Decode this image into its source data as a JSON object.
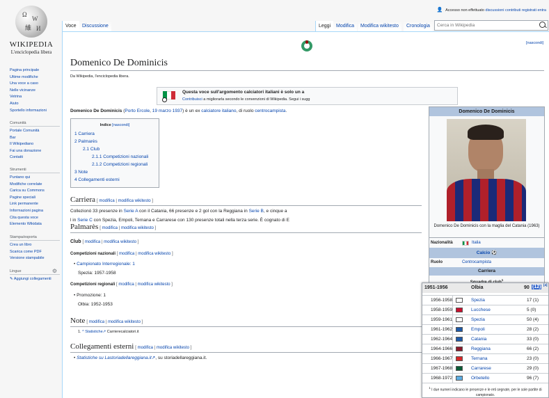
{
  "logo": {
    "wordmark": "WIKIPEDIA",
    "tagline": "L'enciclopedia libera"
  },
  "personal": [
    "Accesso non effettuato",
    "discussioni",
    "contributi",
    "registrati",
    "entra"
  ],
  "tabs_left": [
    "Voce",
    "Discussione"
  ],
  "tabs_right": [
    "Leggi",
    "Modifica",
    "Modifica wikitesto",
    "Cronologia"
  ],
  "search": {
    "placeholder": "Cerca in Wikipedia"
  },
  "sidebar": {
    "nav": [
      "Pagina principale",
      "Ultime modifiche",
      "Una voce a caso",
      "Nelle vicinanze",
      "Vetrina",
      "Aiuto",
      "Sportello informazioni"
    ],
    "community_head": "Comunità",
    "community": [
      "Portale Comunità",
      "Bar",
      "Il Wikipediano",
      "Fai una donazione",
      "Contatti"
    ],
    "tools_head": "Strumenti",
    "tools": [
      "Puntano qui",
      "Modifiche correlate",
      "Carica su Commons",
      "Pagine speciali",
      "Link permanente",
      "Informazioni pagina",
      "Cita questa voce",
      "Elemento Wikidata"
    ],
    "print_head": "Stampa/esporta",
    "print": [
      "Crea un libro",
      "Scarica come PDF",
      "Versione stampabile"
    ],
    "lang_head": "Lingue",
    "lang_add": "Aggiungi collegamenti"
  },
  "article": {
    "nascondi": "[nascondi]",
    "title": "Domenico De Dominicis",
    "from": "Da Wikipedia, l'enciclopedia libera.",
    "stub_line1": "Questa voce sull'argomento calciatori italiani è solo un a",
    "stub_link": "Contribuisci",
    "stub_line2": "a migliorarla secondo le convenzioni di Wikipedia. Segui i sugg",
    "lead": {
      "name": "Domenico De Dominicis",
      "open": "(",
      "place": "Porto Ercole",
      "comma": ", ",
      "date": "19 marzo 1937",
      "mid": ") è un ex ",
      "link1": "calciatore",
      "sp": " ",
      "link2": "italiano",
      "mid2": ", di ruolo ",
      "link3": "centrocampista",
      "end": "."
    },
    "toc": {
      "title": "Indice",
      "hide": "[nascondi]",
      "items": [
        "1 Carriera",
        "2 Palmarès",
        "2.1 Club",
        "2.1.1 Competizioni nazionali",
        "2.1.2 Competizioni regionali",
        "3 Note",
        "4 Collegamenti esterni"
      ]
    },
    "edit": {
      "open": "[ ",
      "mod": "modifica",
      "pipe": " | ",
      "wiki": "modifica wikitesto",
      "close": " ]"
    },
    "carriera": {
      "title": "Carriera",
      "l1a": "Collezionò 33 presenze in ",
      "l1b": "Serie A",
      "l1c": " con il Catania, 66 presenze e 2 gol con la Reggiana in ",
      "l1d": "Serie B",
      "l1e": ", e cinque a",
      "l2a": "l in ",
      "l2b": "Serie C",
      "l2c": " con Spezia, Empoli, Ternana e Carrarese con 130 presenze totali nella terza serie. È cognato di E"
    },
    "palmares": {
      "title": "Palmarès",
      "club": "Club",
      "naz": "Competizioni nazionali",
      "naz_item": "Campionato Interregionale: 1",
      "naz_sub": "Spezia: 1957-1958",
      "reg": "Competizioni regionali",
      "reg_item": "Promozione: 1",
      "reg_sub": "Olbia: 1952-1953"
    },
    "note": {
      "title": "Note",
      "num": "1.",
      "caret": "^",
      "link": "Statistiche",
      "src": " Carrierecalciatori.it"
    },
    "esterni": {
      "title": "Collegamenti esterni",
      "link": "Statistiche su Lastoriadellareggiana.it",
      "rest": ", su storiadellareggiana.it."
    }
  },
  "infobox": {
    "name": "Domenico De Dominicis",
    "caption": "Domenico De Dominicis con la maglia del Catania (1963)",
    "nazionalita_label": "Nazionalità",
    "nazionalita": "Italia",
    "calcio": "Calcio",
    "ruolo_label": "Ruolo",
    "ruolo": "Centrocampista",
    "carriera": "Carriera",
    "squadre": "Squadre di club",
    "sup": "1"
  },
  "club_table": {
    "top": {
      "years": "1951-1956",
      "club": "Olbia",
      "apps": "90",
      "gol": "(12)",
      "sup": "[4]"
    },
    "rows": [
      {
        "years": "1956-1958",
        "club": "Spezia",
        "stats": "17 (1)",
        "flag": "#ffffff"
      },
      {
        "years": "1958-1959",
        "club": "Lucchese",
        "stats": "5 (0)",
        "flag": "#c8102e"
      },
      {
        "years": "1959-1961",
        "club": "Spezia",
        "stats": "50 (4)",
        "flag": "#ffffff"
      },
      {
        "years": "1961-1962",
        "club": "Empoli",
        "stats": "28 (2)",
        "flag": "#1e5aa8"
      },
      {
        "years": "1962-1964",
        "club": "Catania",
        "stats": "33 (0)",
        "flag": "#1e5aa8"
      },
      {
        "years": "1964-1966",
        "club": "Reggiana",
        "stats": "66 (2)",
        "flag": "#8b1a2b"
      },
      {
        "years": "1966-1967",
        "club": "Ternana",
        "stats": "23 (0)",
        "flag": "#d62828"
      },
      {
        "years": "1967-1968",
        "club": "Carrarese",
        "stats": "29 (0)",
        "flag": "#0a5c36"
      },
      {
        "years": "1968-1972",
        "club": "Orbetello",
        "stats": "96 (7)",
        "flag": "#5dade2"
      }
    ],
    "foot_sup": "1",
    "foot": "I due numeri indicano le presenze e le reti segnate, per le sole partite di campionato."
  }
}
